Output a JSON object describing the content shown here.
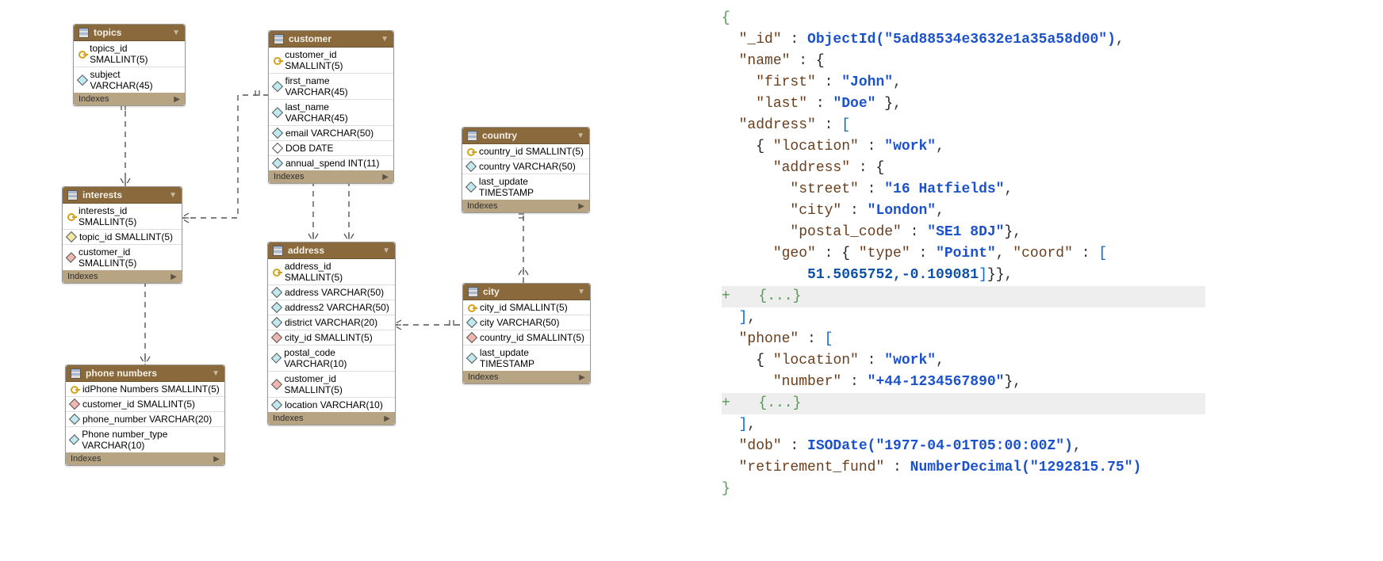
{
  "erd": {
    "indexes_label": "Indexes",
    "tables": {
      "topics": {
        "title": "topics",
        "cols": [
          {
            "icon": "key",
            "label": "topics_id SMALLINT(5)"
          },
          {
            "icon": "cyan",
            "label": "subject VARCHAR(45)"
          }
        ]
      },
      "interests": {
        "title": "interests",
        "cols": [
          {
            "icon": "key",
            "label": "interests_id SMALLINT(5)"
          },
          {
            "icon": "yellow",
            "label": "topic_id SMALLINT(5)"
          },
          {
            "icon": "red",
            "label": "customer_id SMALLINT(5)"
          }
        ]
      },
      "phone": {
        "title": "phone numbers",
        "cols": [
          {
            "icon": "key",
            "label": "idPhone Numbers SMALLINT(5)"
          },
          {
            "icon": "red",
            "label": "customer_id SMALLINT(5)"
          },
          {
            "icon": "cyan",
            "label": "phone_number VARCHAR(20)"
          },
          {
            "icon": "cyan",
            "label": "Phone number_type VARCHAR(10)"
          }
        ]
      },
      "customer": {
        "title": "customer",
        "cols": [
          {
            "icon": "key",
            "label": "customer_id SMALLINT(5)"
          },
          {
            "icon": "cyan",
            "label": "first_name VARCHAR(45)"
          },
          {
            "icon": "cyan",
            "label": "last_name VARCHAR(45)"
          },
          {
            "icon": "cyan",
            "label": "email VARCHAR(50)"
          },
          {
            "icon": "white",
            "label": "DOB DATE"
          },
          {
            "icon": "cyan",
            "label": "annual_spend INT(11)"
          }
        ]
      },
      "address": {
        "title": "address",
        "cols": [
          {
            "icon": "key",
            "label": "address_id SMALLINT(5)"
          },
          {
            "icon": "cyan",
            "label": "address VARCHAR(50)"
          },
          {
            "icon": "cyan",
            "label": "address2 VARCHAR(50)"
          },
          {
            "icon": "cyan",
            "label": "district VARCHAR(20)"
          },
          {
            "icon": "red",
            "label": "city_id SMALLINT(5)"
          },
          {
            "icon": "cyan",
            "label": "postal_code VARCHAR(10)"
          },
          {
            "icon": "red",
            "label": "customer_id SMALLINT(5)"
          },
          {
            "icon": "cyan",
            "label": "location VARCHAR(10)"
          }
        ]
      },
      "country": {
        "title": "country",
        "cols": [
          {
            "icon": "key",
            "label": "country_id SMALLINT(5)"
          },
          {
            "icon": "cyan",
            "label": "country VARCHAR(50)"
          },
          {
            "icon": "cyan",
            "label": "last_update TIMESTAMP"
          }
        ]
      },
      "city": {
        "title": "city",
        "cols": [
          {
            "icon": "key",
            "label": "city_id SMALLINT(5)"
          },
          {
            "icon": "cyan",
            "label": "city VARCHAR(50)"
          },
          {
            "icon": "red",
            "label": "country_id SMALLINT(5)"
          },
          {
            "icon": "cyan",
            "label": "last_update TIMESTAMP"
          }
        ]
      }
    }
  },
  "json": {
    "id_key": "\"_id\"",
    "id_fn": "ObjectId(",
    "id_val": "\"5ad88534e3632e1a35a58d00\"",
    "name_key": "\"name\"",
    "first_key": "\"first\"",
    "first_val": "\"John\"",
    "last_key": "\"last\"",
    "last_val": "\"Doe\"",
    "address_key": "\"address\"",
    "location_key": "\"location\"",
    "work_val": "\"work\"",
    "street_key": "\"street\"",
    "street_val": "\"16 Hatfields\"",
    "city_key": "\"city\"",
    "city_val": "\"London\"",
    "postal_key": "\"postal_code\"",
    "postal_val": "\"SE1 8DJ\"",
    "geo_key": "\"geo\"",
    "type_key": "\"type\"",
    "point_val": "\"Point\"",
    "coord_key": "\"coord\"",
    "coord_nums": "51.5065752,-0.109081",
    "fold": "{...}",
    "phone_key": "\"phone\"",
    "number_key": "\"number\"",
    "number_val": "\"+44-1234567890\"",
    "dob_key": "\"dob\"",
    "dob_fn": "ISODate(",
    "dob_val": "\"1977-04-01T05:00:00Z\"",
    "ret_key": "\"retirement_fund\"",
    "ret_fn": "NumberDecimal(",
    "ret_val": "\"1292815.75\""
  }
}
